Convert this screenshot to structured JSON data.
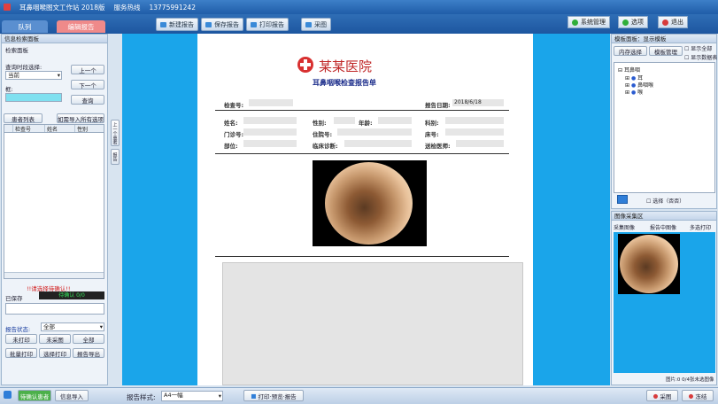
{
  "titlebar": {
    "app_name": "耳鼻咽喉图文工作站 2018版",
    "contact_label": "服务热线",
    "phone": "13775991242"
  },
  "tabs": {
    "tab1": "队列",
    "tab2": "编辑报告"
  },
  "toolbar": {
    "new_report": "新建报告",
    "save_report": "保存报告",
    "print_report": "打印报告",
    "capture": "采图"
  },
  "right_toolbar": {
    "system_mgmt": "系统管理",
    "options": "选项",
    "exit": "退出"
  },
  "left_panel": {
    "header": "信息检索面板",
    "section_title": "检索面板",
    "query_label": "查询时段选择:",
    "query_value": "当前",
    "prev_button": "上一个",
    "next_button": "下一个",
    "query_button": "查询",
    "patient_list_tab": "患者列表",
    "load_tab": "如需导入所有选项",
    "columns": [
      "检查号",
      "姓名",
      "性别"
    ],
    "warning": "!!请选择待确认!!",
    "status_label": "已保存",
    "status_value": "待确认   0/0",
    "filter_label": "报告状态:",
    "filter_value": "全部",
    "unprinted": "未打印",
    "not_captured": "未采图",
    "select_all": "全部",
    "batch_print": "批量打印",
    "select_print": "选择打印",
    "batch_export": "报告导出"
  },
  "side_strip": {
    "a": "上一个患者",
    "b": "报告"
  },
  "report": {
    "hospital": "某某医院",
    "title": "耳鼻咽喉检查报告单",
    "exam_no_label": "检查号:",
    "report_date_label": "报告日期:",
    "report_date_value": "2018/6/18",
    "name_label": "姓名:",
    "gender_label": "性别:",
    "age_label": "年龄:",
    "dept_label": "科别:",
    "clinic_label": "门诊号:",
    "ward_label": "住院号:",
    "bed_label": "床号:",
    "site_label": "部位:",
    "diagnosis_label": "临床诊断:",
    "doctor_label": "送检医师:"
  },
  "right_panel": {
    "header": "模板面板：显示模板",
    "tab1": "内存选择",
    "tab2": "模板管理",
    "opt1": "显示全部",
    "opt2": "显示数据表",
    "tree_root": "耳鼻咽",
    "tree_items": [
      "耳",
      "鼻咽喉",
      "喉"
    ],
    "confirm_label": "选择（否否）",
    "image_header": "图像采集区",
    "img_tab1": "采集图像",
    "img_tab2": "报告中图像",
    "img_tab3": "多选打印",
    "image_count": "图片:0",
    "image_count2": "0/4张未选图像"
  },
  "bottom": {
    "ready_button": "待确认患者",
    "info_import": "信息导入",
    "format_label": "报告样式:",
    "format_value": "A4一幅",
    "print_preview": "打印·预览·报告",
    "capture_btn": "采图",
    "freeze_btn": "冻结"
  }
}
